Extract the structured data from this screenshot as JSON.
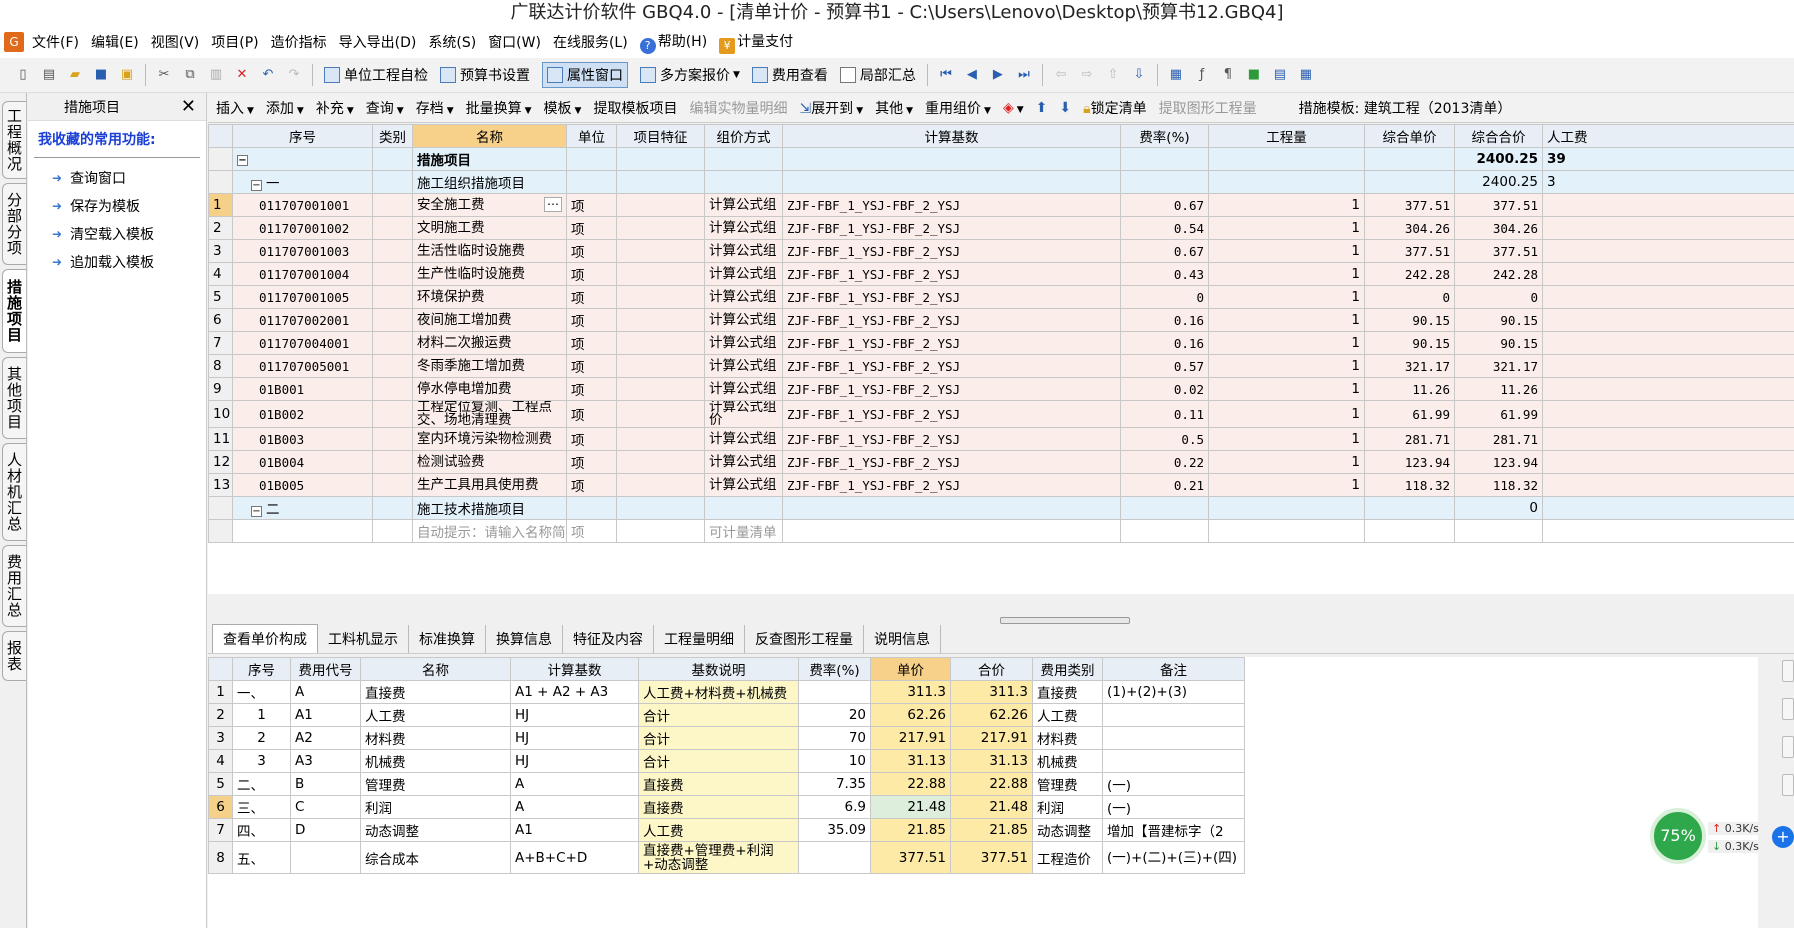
{
  "window": {
    "title": "广联达计价软件 GBQ4.0 - [清单计价 - 预算书1 - C:\\Users\\Lenovo\\Desktop\\预算书12.GBQ4]"
  },
  "menubar": {
    "items": [
      "文件(F)",
      "编辑(E)",
      "视图(V)",
      "项目(P)",
      "造价指标",
      "导入导出(D)",
      "系统(S)",
      "窗口(W)",
      "在线服务(L)",
      "帮助(H)",
      "计量支付"
    ]
  },
  "toolbar": {
    "check": "单位工程自检",
    "settings": "预算书设置",
    "property": "属性窗口",
    "multi": "多方案报价",
    "fee_view": "费用查看",
    "local_sum": "局部汇总"
  },
  "left_tabs": [
    "工程概况",
    "分部分项",
    "措施项目",
    "其他项目",
    "人材机汇总",
    "费用汇总",
    "报表"
  ],
  "left_panel": {
    "title": "措施项目",
    "fav_title": "我收藏的常用功能:",
    "items": [
      "查询窗口",
      "保存为模板",
      "清空载入模板",
      "追加载入模板"
    ]
  },
  "subtoolbar": {
    "items": [
      "插入",
      "添加",
      "补充",
      "查询",
      "存档",
      "批量换算",
      "模板",
      "提取模板项目",
      "编辑实物量明细",
      "展开到",
      "其他",
      "重用组价",
      "锁定清单",
      "提取图形工程量"
    ],
    "template_label": "措施模板: 建筑工程（2013清单）"
  },
  "upper_table": {
    "headers": [
      "序号",
      "类别",
      "名称",
      "单位",
      "项目特征",
      "组价方式",
      "计算基数",
      "费率(%)",
      "工程量",
      "综合单价",
      "综合合价",
      "人工费"
    ],
    "top_row": {
      "name": "措施项目",
      "total": "2400.25",
      "labor": "39"
    },
    "group1": {
      "index": "一",
      "name": "施工组织措施项目",
      "total": "2400.25",
      "labor": "3"
    },
    "rows": [
      {
        "n": "1",
        "code": "011707001001",
        "name": "安全施工费",
        "unit": "项",
        "method": "计算公式组",
        "base": "ZJF-FBF_1_YSJ-FBF_2_YSJ",
        "rate": "0.67",
        "qty": "1",
        "price": "377.51",
        "total": "377.51"
      },
      {
        "n": "2",
        "code": "011707001002",
        "name": "文明施工费",
        "unit": "项",
        "method": "计算公式组",
        "base": "ZJF-FBF_1_YSJ-FBF_2_YSJ",
        "rate": "0.54",
        "qty": "1",
        "price": "304.26",
        "total": "304.26"
      },
      {
        "n": "3",
        "code": "011707001003",
        "name": "生活性临时设施费",
        "unit": "项",
        "method": "计算公式组",
        "base": "ZJF-FBF_1_YSJ-FBF_2_YSJ",
        "rate": "0.67",
        "qty": "1",
        "price": "377.51",
        "total": "377.51"
      },
      {
        "n": "4",
        "code": "011707001004",
        "name": "生产性临时设施费",
        "unit": "项",
        "method": "计算公式组",
        "base": "ZJF-FBF_1_YSJ-FBF_2_YSJ",
        "rate": "0.43",
        "qty": "1",
        "price": "242.28",
        "total": "242.28"
      },
      {
        "n": "5",
        "code": "011707001005",
        "name": "环境保护费",
        "unit": "项",
        "method": "计算公式组",
        "base": "ZJF-FBF_1_YSJ-FBF_2_YSJ",
        "rate": "0",
        "qty": "1",
        "price": "0",
        "total": "0"
      },
      {
        "n": "6",
        "code": "011707002001",
        "name": "夜间施工增加费",
        "unit": "项",
        "method": "计算公式组",
        "base": "ZJF-FBF_1_YSJ-FBF_2_YSJ",
        "rate": "0.16",
        "qty": "1",
        "price": "90.15",
        "total": "90.15"
      },
      {
        "n": "7",
        "code": "011707004001",
        "name": "材料二次搬运费",
        "unit": "项",
        "method": "计算公式组",
        "base": "ZJF-FBF_1_YSJ-FBF_2_YSJ",
        "rate": "0.16",
        "qty": "1",
        "price": "90.15",
        "total": "90.15"
      },
      {
        "n": "8",
        "code": "011707005001",
        "name": "冬雨季施工增加费",
        "unit": "项",
        "method": "计算公式组",
        "base": "ZJF-FBF_1_YSJ-FBF_2_YSJ",
        "rate": "0.57",
        "qty": "1",
        "price": "321.17",
        "total": "321.17"
      },
      {
        "n": "9",
        "code": "01B001",
        "name": "停水停电增加费",
        "unit": "项",
        "method": "计算公式组",
        "base": "ZJF-FBF_1_YSJ-FBF_2_YSJ",
        "rate": "0.02",
        "qty": "1",
        "price": "11.26",
        "total": "11.26"
      },
      {
        "n": "10",
        "code": "01B002",
        "name": "工程定位复测、工程点交、场地清理费",
        "unit": "项",
        "method": "计算公式组价",
        "base": "ZJF-FBF_1_YSJ-FBF_2_YSJ",
        "rate": "0.11",
        "qty": "1",
        "price": "61.99",
        "total": "61.99"
      },
      {
        "n": "11",
        "code": "01B003",
        "name": "室内环境污染物检测费",
        "unit": "项",
        "method": "计算公式组",
        "base": "ZJF-FBF_1_YSJ-FBF_2_YSJ",
        "rate": "0.5",
        "qty": "1",
        "price": "281.71",
        "total": "281.71"
      },
      {
        "n": "12",
        "code": "01B004",
        "name": "检测试验费",
        "unit": "项",
        "method": "计算公式组",
        "base": "ZJF-FBF_1_YSJ-FBF_2_YSJ",
        "rate": "0.22",
        "qty": "1",
        "price": "123.94",
        "total": "123.94"
      },
      {
        "n": "13",
        "code": "01B005",
        "name": "生产工具用具使用费",
        "unit": "项",
        "method": "计算公式组",
        "base": "ZJF-FBF_1_YSJ-FBF_2_YSJ",
        "rate": "0.21",
        "qty": "1",
        "price": "118.32",
        "total": "118.32"
      }
    ],
    "group2": {
      "index": "二",
      "name": "施工技术措施项目",
      "total": "0"
    },
    "partial_row": {
      "name": "自动提示：请输入名称简",
      "unit": "项",
      "method": "可计量清单"
    }
  },
  "bottom_tabs": [
    "查看单价构成",
    "工料机显示",
    "标准换算",
    "换算信息",
    "特征及内容",
    "工程量明细",
    "反查图形工程量",
    "说明信息"
  ],
  "lower_table": {
    "headers": [
      "序号",
      "费用代号",
      "名称",
      "计算基数",
      "基数说明",
      "费率(%)",
      "单价",
      "合价",
      "费用类别",
      "备注"
    ],
    "rows": [
      {
        "n": "1",
        "seq": "一、",
        "code": "A",
        "name": "直接费",
        "base": "A1 + A2 + A3",
        "desc": "人工费+材料费+机械费",
        "rate": "",
        "price": "311.3",
        "total": "311.3",
        "cat": "直接费",
        "note": "(1)+(2)+(3)"
      },
      {
        "n": "2",
        "seq": "1",
        "code": "A1",
        "name": "人工费",
        "base": "HJ",
        "desc": "合计",
        "rate": "20",
        "price": "62.26",
        "total": "62.26",
        "cat": "人工费",
        "note": ""
      },
      {
        "n": "3",
        "seq": "2",
        "code": "A2",
        "name": "材料费",
        "base": "HJ",
        "desc": "合计",
        "rate": "70",
        "price": "217.91",
        "total": "217.91",
        "cat": "材料费",
        "note": ""
      },
      {
        "n": "4",
        "seq": "3",
        "code": "A3",
        "name": "机械费",
        "base": "HJ",
        "desc": "合计",
        "rate": "10",
        "price": "31.13",
        "total": "31.13",
        "cat": "机械费",
        "note": ""
      },
      {
        "n": "5",
        "seq": "二、",
        "code": "B",
        "name": "管理费",
        "base": "A",
        "desc": "直接费",
        "rate": "7.35",
        "price": "22.88",
        "total": "22.88",
        "cat": "管理费",
        "note": "(一)"
      },
      {
        "n": "6",
        "seq": "三、",
        "code": "C",
        "name": "利润",
        "base": "A",
        "desc": "直接费",
        "rate": "6.9",
        "price": "21.48",
        "total": "21.48",
        "cat": "利润",
        "note": "(一)"
      },
      {
        "n": "7",
        "seq": "四、",
        "code": "D",
        "name": "动态调整",
        "base": "A1",
        "desc": "人工费",
        "rate": "35.09",
        "price": "21.85",
        "total": "21.85",
        "cat": "动态调整",
        "note": "增加【晋建标字（2"
      },
      {
        "n": "8",
        "seq": "五、",
        "code": "",
        "name": "综合成本",
        "base": "A+B+C+D",
        "desc": "直接费+管理费+利润+动态调整",
        "rate": "",
        "price": "377.51",
        "total": "377.51",
        "cat": "工程造价",
        "note": "(一)+(二)+(三)+(四)"
      }
    ]
  },
  "network_widget": {
    "percent": "75%",
    "up": "0.3K/s",
    "down": "0.3K/s"
  }
}
